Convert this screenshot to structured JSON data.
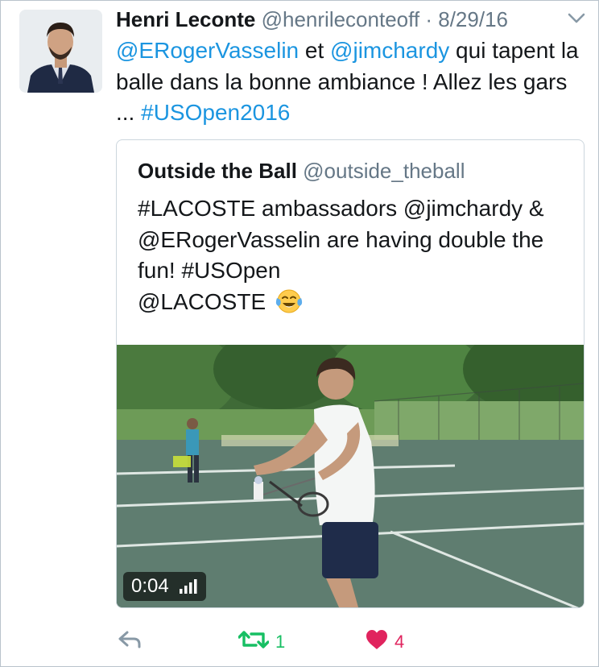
{
  "tweet": {
    "author_name": "Henri Leconte",
    "author_handle": "@henrileconteoff",
    "separator": "·",
    "date": "8/29/16",
    "text_parts": {
      "mention1": "@ERogerVasselin",
      "t1": " et ",
      "mention2": "@jimchardy",
      "t2": " qui tapent la balle dans la bonne ambiance ! Allez les gars ... ",
      "hashtag": "#USOpen2016"
    }
  },
  "quoted": {
    "name": "Outside the Ball",
    "handle": "@outside_theball",
    "text_line1": "#LACOSTE ambassadors @jimchardy & @ERogerVasselin are having double the fun! #USOpen",
    "text_line2": "@LACOSTE",
    "emoji_icon": "face-with-tears-of-joy-icon"
  },
  "video": {
    "duration": "0:04",
    "signal_icon": "signal-bars-icon"
  },
  "actions": {
    "reply_icon": "reply-icon",
    "retweet_icon": "retweet-icon",
    "retweet_count": "1",
    "like_icon": "heart-icon",
    "like_count": "4"
  },
  "colors": {
    "link": "#1b95e0",
    "retweet": "#17bf63",
    "like": "#e0245e",
    "muted": "#657786"
  }
}
